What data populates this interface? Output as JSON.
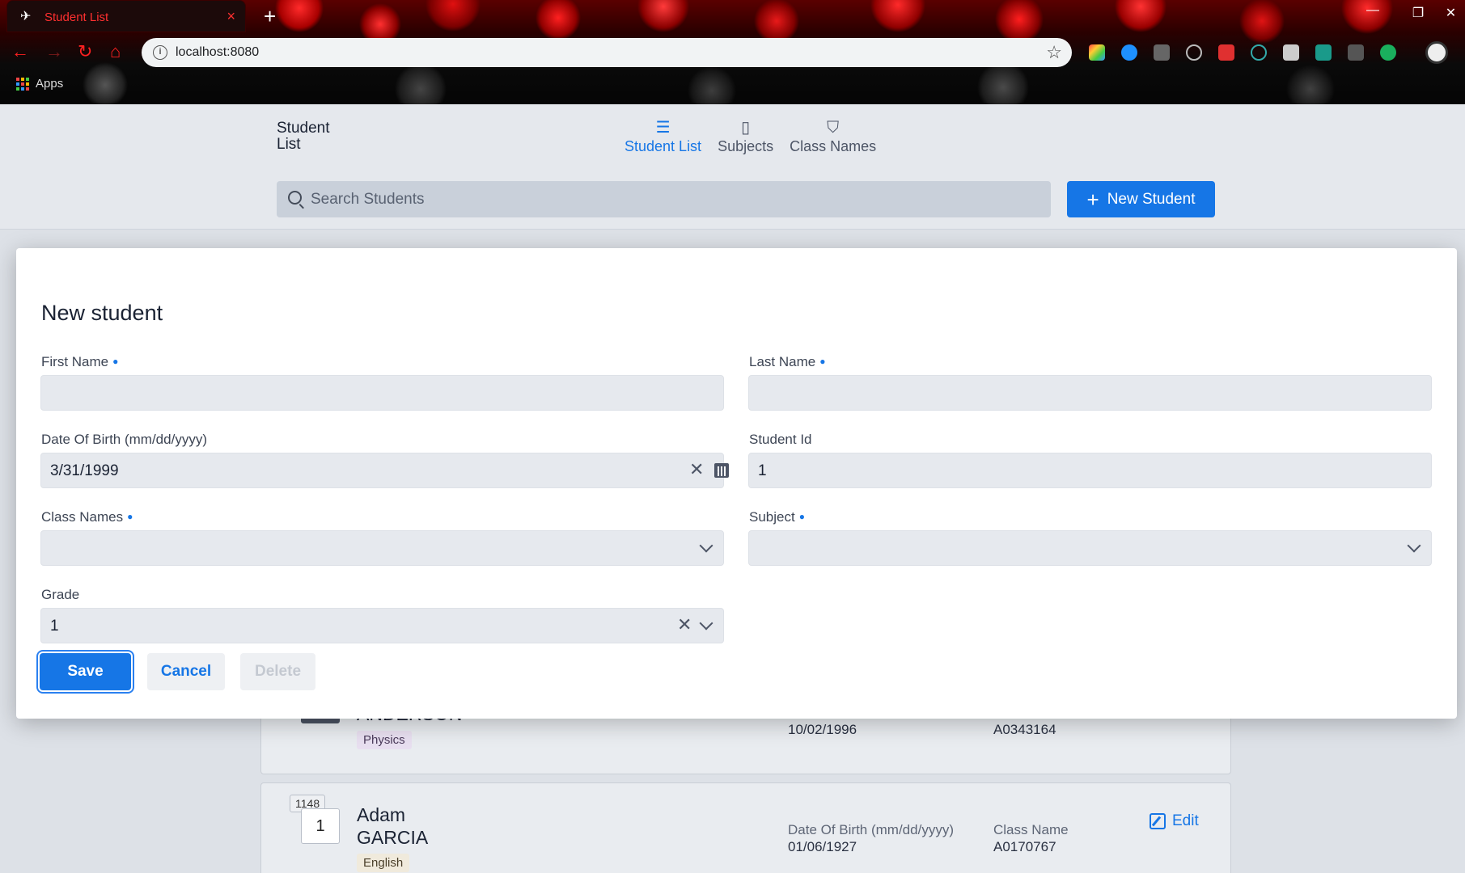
{
  "browser": {
    "tab_title": "Student List",
    "tab_close": "×",
    "new_tab": "+",
    "url": "localhost:8080",
    "bookmarks_apps": "Apps",
    "window_minimize": "—",
    "window_restore": "❐",
    "window_close": "✕"
  },
  "app": {
    "brand": "Student List",
    "nav": [
      {
        "label": "Student List",
        "icon": "list-icon",
        "active": true
      },
      {
        "label": "Subjects",
        "icon": "book-icon",
        "active": false
      },
      {
        "label": "Class Names",
        "icon": "graduation-cap-icon",
        "active": false
      }
    ],
    "search_placeholder": "Search Students",
    "new_student_label": "New Student",
    "accent_color": "#1676e6"
  },
  "dialog": {
    "title": "New student",
    "fields": {
      "first_name": {
        "label": "First Name",
        "value": "",
        "required": true
      },
      "last_name": {
        "label": "Last Name",
        "value": "",
        "required": true
      },
      "dob": {
        "label": "Date Of Birth (mm/dd/yyyy)",
        "value": "3/31/1999"
      },
      "student_id": {
        "label": "Student Id",
        "value": "1"
      },
      "class_names": {
        "label": "Class Names",
        "value": "",
        "required": true
      },
      "subject": {
        "label": "Subject",
        "value": "",
        "required": true
      },
      "grade": {
        "label": "Grade",
        "value": "1"
      }
    },
    "buttons": {
      "save": "Save",
      "cancel": "Cancel",
      "delete": "Delete"
    }
  },
  "students": [
    {
      "last_name": "ANDERSON",
      "subject": "Physics",
      "dob": "10/02/1996",
      "class_name": "A0343164"
    },
    {
      "id": "1148",
      "grade": "1",
      "first_name": "Adam",
      "last_name": "GARCIA",
      "subject": "English",
      "dob_label": "Date Of Birth (mm/dd/yyyy)",
      "dob": "01/06/1927",
      "class_label": "Class Name",
      "class_name": "A0170767",
      "edit_label": "Edit"
    }
  ]
}
